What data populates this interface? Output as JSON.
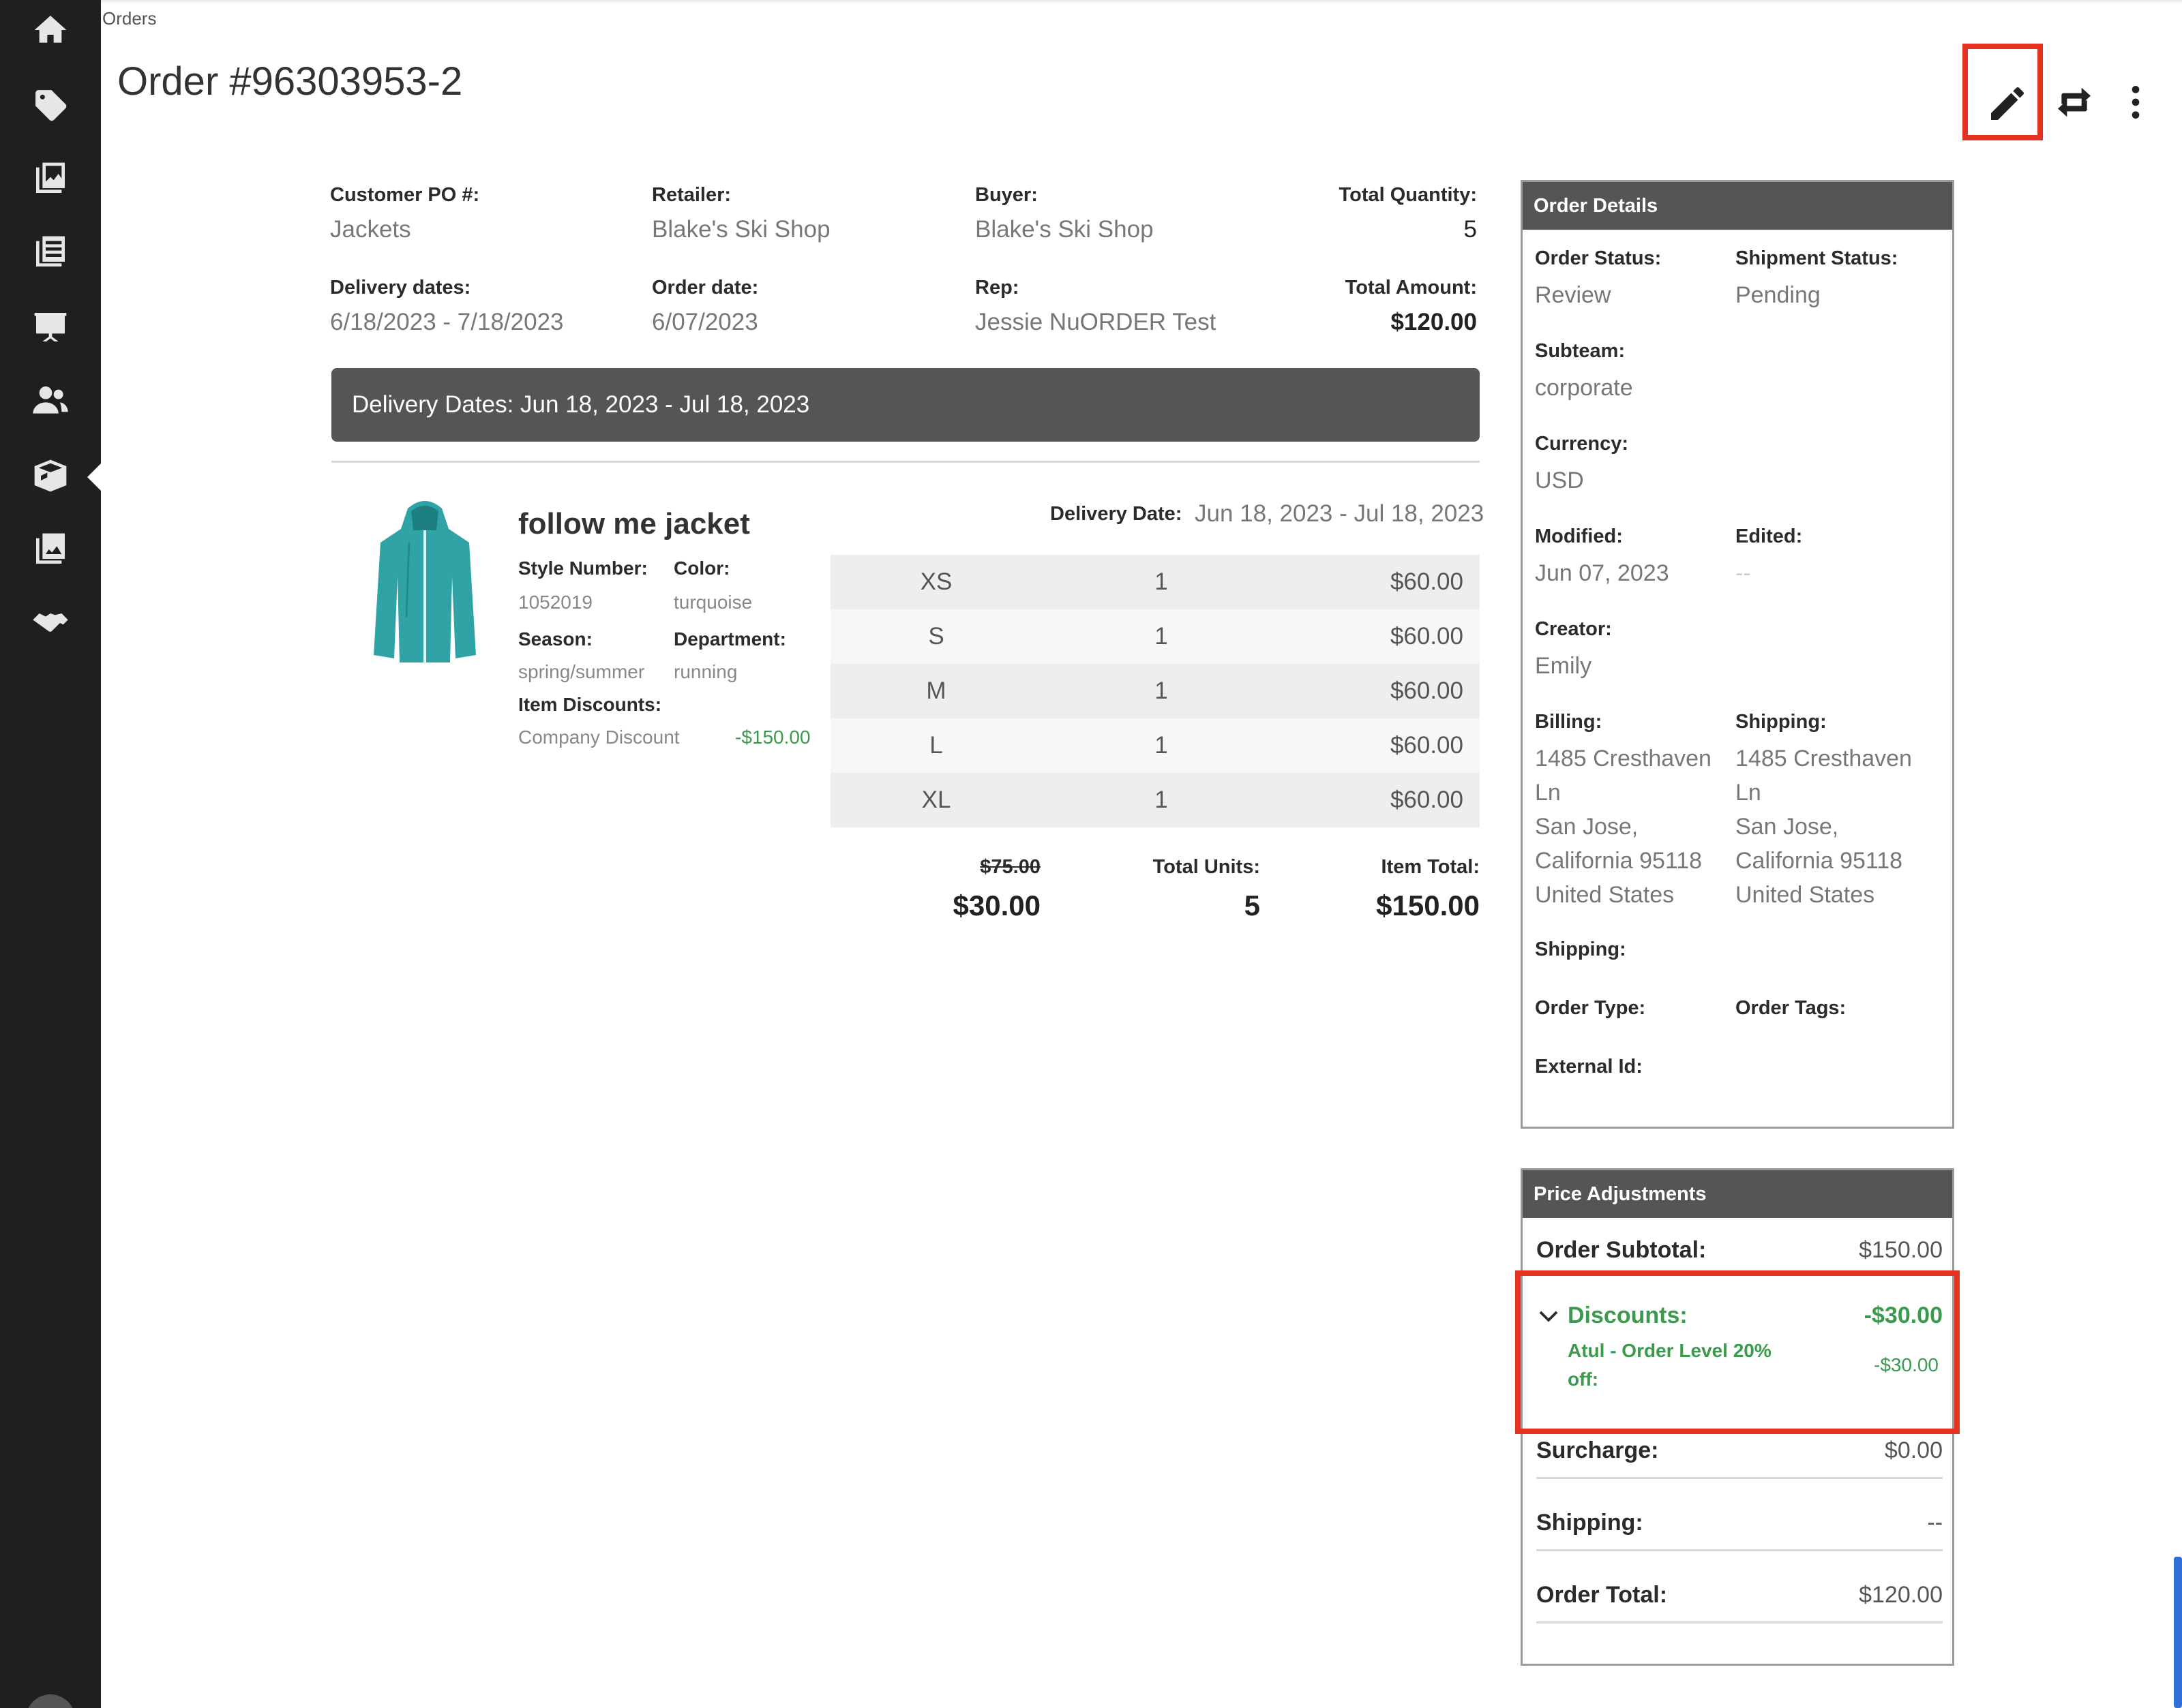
{
  "breadcrumb": "Orders",
  "title": "Order #96303953-2",
  "sidebar_icons": [
    "home-icon",
    "tag-icon",
    "catalog-icon",
    "linesheet-icon",
    "presentation-icon",
    "customers-icon",
    "orders-icon",
    "images-icon",
    "handshake-icon"
  ],
  "summary": {
    "customer_po_label": "Customer PO #:",
    "customer_po": "Jackets",
    "retailer_label": "Retailer:",
    "retailer": "Blake's Ski Shop",
    "buyer_label": "Buyer:",
    "buyer": "Blake's Ski Shop",
    "total_qty_label": "Total Quantity:",
    "total_qty": "5",
    "delivery_dates_label": "Delivery dates:",
    "delivery_dates": "6/18/2023 - 7/18/2023",
    "order_date_label": "Order date:",
    "order_date": "6/07/2023",
    "rep_label": "Rep:",
    "rep": "Jessie NuORDER Test",
    "total_amount_label": "Total Amount:",
    "total_amount": "$120.00"
  },
  "delivery_bar": "Delivery Dates: Jun 18, 2023 - Jul 18, 2023",
  "item": {
    "name": "follow me jacket",
    "style_label": "Style Number:",
    "style": "1052019",
    "color_label": "Color:",
    "color": "turquoise",
    "season_label": "Season:",
    "season": "spring/summer",
    "department_label": "Department:",
    "department": "running",
    "discounts_label": "Item Discounts:",
    "discount_name": "Company Discount",
    "discount_value": "-$150.00",
    "delivery_date_label": "Delivery Date:",
    "delivery_date": "Jun 18, 2023 - Jul 18, 2023",
    "sizes": [
      {
        "size": "XS",
        "qty": "1",
        "price": "$60.00"
      },
      {
        "size": "S",
        "qty": "1",
        "price": "$60.00"
      },
      {
        "size": "M",
        "qty": "1",
        "price": "$60.00"
      },
      {
        "size": "L",
        "qty": "1",
        "price": "$60.00"
      },
      {
        "size": "XL",
        "qty": "1",
        "price": "$60.00"
      }
    ],
    "original_price": "$75.00",
    "unit_price": "$30.00",
    "total_units_label": "Total Units:",
    "total_units": "5",
    "item_total_label": "Item Total:",
    "item_total": "$150.00"
  },
  "order_details": {
    "header": "Order Details",
    "order_status_label": "Order Status:",
    "order_status": "Review",
    "shipment_status_label": "Shipment Status:",
    "shipment_status": "Pending",
    "subteam_label": "Subteam:",
    "subteam": "corporate",
    "currency_label": "Currency:",
    "currency": "USD",
    "modified_label": "Modified:",
    "modified": "Jun 07, 2023",
    "edited_label": "Edited:",
    "edited": "--",
    "creator_label": "Creator:",
    "creator": "Emily",
    "billing_label": "Billing:",
    "billing": [
      "1485 Cresthaven",
      "Ln",
      "San Jose,",
      "California 95118",
      "United States"
    ],
    "shipping_addr_label": "Shipping:",
    "shipping_addr": [
      "1485 Cresthaven",
      "Ln",
      "San Jose,",
      "California 95118",
      "United States"
    ],
    "shipping_label": "Shipping:",
    "order_type_label": "Order Type:",
    "order_tags_label": "Order Tags:",
    "external_id_label": "External Id:"
  },
  "price_adjustments": {
    "header": "Price Adjustments",
    "subtotal_label": "Order Subtotal:",
    "subtotal": "$150.00",
    "discounts_label": "Discounts:",
    "discounts": "-$30.00",
    "discount_item": "Atul - Order Level 20% off:",
    "discount_item_value": "-$30.00",
    "surcharge_label": "Surcharge:",
    "surcharge": "$0.00",
    "shipping_label": "Shipping:",
    "shipping": "--",
    "total_label": "Order Total:",
    "total": "$120.00"
  },
  "colors": {
    "sidebar": "#1f1f1f",
    "panel_header": "#555555",
    "discount_green": "#3b9a4e",
    "highlight": "#e53222"
  }
}
